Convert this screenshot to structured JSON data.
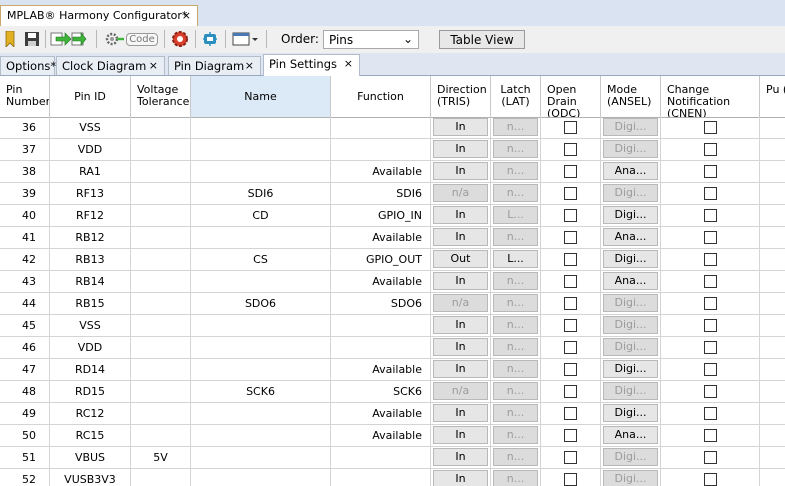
{
  "window": {
    "tab_title": "MPLAB® Harmony Configurator*",
    "close": "×"
  },
  "toolbar": {
    "order_label": "Order:",
    "order_value": "Pins",
    "table_view_label": "Table View",
    "code_label": "Code"
  },
  "tabs": [
    {
      "label": "Options*"
    },
    {
      "label": "Clock Diagram",
      "close": "×"
    },
    {
      "label": "Pin Diagram",
      "close": "×"
    },
    {
      "label": "Pin Settings",
      "close": "×"
    }
  ],
  "columns": [
    {
      "label": "Pin Number"
    },
    {
      "label": "Pin ID"
    },
    {
      "label": "Voltage Tolerance"
    },
    {
      "label": "Name"
    },
    {
      "label": "Function"
    },
    {
      "label": "Direction (TRIS)"
    },
    {
      "label": "Latch (LAT)"
    },
    {
      "label": "Open Drain (ODC)"
    },
    {
      "label": "Mode (ANSEL)"
    },
    {
      "label": "Change Notification (CNEN)"
    },
    {
      "label": "Pu (C"
    }
  ],
  "rows": [
    {
      "pin": "36",
      "id": "VSS",
      "volt": "",
      "name": "",
      "func": "",
      "dir": "In",
      "dir_enabled": true,
      "lat": "n...",
      "lat_enabled": false,
      "mode": "Digi...",
      "mode_enabled": false
    },
    {
      "pin": "37",
      "id": "VDD",
      "volt": "",
      "name": "",
      "func": "",
      "dir": "In",
      "dir_enabled": true,
      "lat": "n...",
      "lat_enabled": false,
      "mode": "Digi...",
      "mode_enabled": false
    },
    {
      "pin": "38",
      "id": "RA1",
      "volt": "",
      "name": "",
      "func": "Available",
      "dir": "In",
      "dir_enabled": true,
      "lat": "n...",
      "lat_enabled": false,
      "mode": "Ana...",
      "mode_enabled": true
    },
    {
      "pin": "39",
      "id": "RF13",
      "volt": "",
      "name": "SDI6",
      "func": "SDI6",
      "dir": "n/a",
      "dir_enabled": false,
      "lat": "n...",
      "lat_enabled": false,
      "mode": "Digi...",
      "mode_enabled": false
    },
    {
      "pin": "40",
      "id": "RF12",
      "volt": "",
      "name": "CD",
      "func": "GPIO_IN",
      "dir": "In",
      "dir_enabled": true,
      "lat": "L...",
      "lat_enabled": false,
      "mode": "Digi...",
      "mode_enabled": true
    },
    {
      "pin": "41",
      "id": "RB12",
      "volt": "",
      "name": "",
      "func": "Available",
      "dir": "In",
      "dir_enabled": true,
      "lat": "n...",
      "lat_enabled": false,
      "mode": "Ana...",
      "mode_enabled": true
    },
    {
      "pin": "42",
      "id": "RB13",
      "volt": "",
      "name": "CS",
      "func": "GPIO_OUT",
      "dir": "Out",
      "dir_enabled": true,
      "lat": "L...",
      "lat_enabled": true,
      "mode": "Digi...",
      "mode_enabled": true
    },
    {
      "pin": "43",
      "id": "RB14",
      "volt": "",
      "name": "",
      "func": "Available",
      "dir": "In",
      "dir_enabled": true,
      "lat": "n...",
      "lat_enabled": false,
      "mode": "Ana...",
      "mode_enabled": true
    },
    {
      "pin": "44",
      "id": "RB15",
      "volt": "",
      "name": "SDO6",
      "func": "SDO6",
      "dir": "n/a",
      "dir_enabled": false,
      "lat": "n...",
      "lat_enabled": false,
      "mode": "Digi...",
      "mode_enabled": false
    },
    {
      "pin": "45",
      "id": "VSS",
      "volt": "",
      "name": "",
      "func": "",
      "dir": "In",
      "dir_enabled": true,
      "lat": "n...",
      "lat_enabled": false,
      "mode": "Digi...",
      "mode_enabled": false
    },
    {
      "pin": "46",
      "id": "VDD",
      "volt": "",
      "name": "",
      "func": "",
      "dir": "In",
      "dir_enabled": true,
      "lat": "n...",
      "lat_enabled": false,
      "mode": "Digi...",
      "mode_enabled": false
    },
    {
      "pin": "47",
      "id": "RD14",
      "volt": "",
      "name": "",
      "func": "Available",
      "dir": "In",
      "dir_enabled": true,
      "lat": "n...",
      "lat_enabled": false,
      "mode": "Digi...",
      "mode_enabled": true
    },
    {
      "pin": "48",
      "id": "RD15",
      "volt": "",
      "name": "SCK6",
      "func": "SCK6",
      "dir": "n/a",
      "dir_enabled": false,
      "lat": "n...",
      "lat_enabled": false,
      "mode": "Digi...",
      "mode_enabled": false
    },
    {
      "pin": "49",
      "id": "RC12",
      "volt": "",
      "name": "",
      "func": "Available",
      "dir": "In",
      "dir_enabled": true,
      "lat": "n...",
      "lat_enabled": false,
      "mode": "Digi...",
      "mode_enabled": true
    },
    {
      "pin": "50",
      "id": "RC15",
      "volt": "",
      "name": "",
      "func": "Available",
      "dir": "In",
      "dir_enabled": true,
      "lat": "n...",
      "lat_enabled": false,
      "mode": "Ana...",
      "mode_enabled": true
    },
    {
      "pin": "51",
      "id": "VBUS",
      "volt": "5V",
      "name": "",
      "func": "",
      "dir": "In",
      "dir_enabled": true,
      "lat": "n...",
      "lat_enabled": false,
      "mode": "Digi...",
      "mode_enabled": false
    },
    {
      "pin": "52",
      "id": "VUSB3V3",
      "volt": "",
      "name": "",
      "func": "",
      "dir": "In",
      "dir_enabled": true,
      "lat": "n...",
      "lat_enabled": false,
      "mode": "Digi...",
      "mode_enabled": false
    }
  ]
}
